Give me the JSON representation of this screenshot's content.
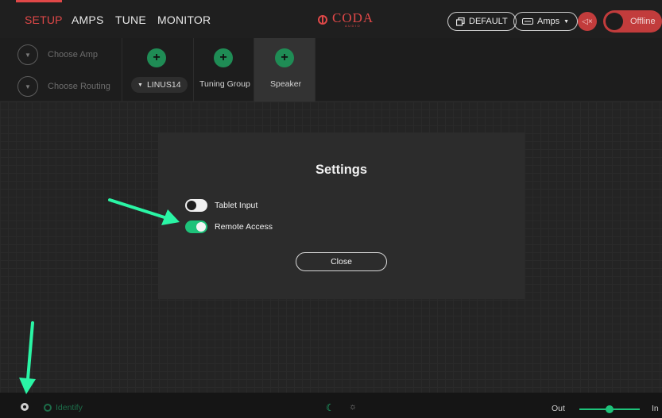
{
  "topbar": {
    "tabs": [
      {
        "label": "SETUP",
        "active": true
      },
      {
        "label": "AMPS",
        "active": false
      },
      {
        "label": "TUNE",
        "active": false
      },
      {
        "label": "MONITOR",
        "active": false
      }
    ],
    "logo": {
      "text": "CODA",
      "sub": "AUDIO"
    },
    "default_label": "DEFAULT",
    "amps_label": "Amps",
    "offline_label": "Offline"
  },
  "subbar": {
    "choose_amp": "Choose Amp",
    "choose_routing": "Choose Routing",
    "groups": [
      {
        "label": "LINUS14",
        "selected": false
      },
      {
        "label": "Tuning Group",
        "selected": false
      },
      {
        "label": "Speaker",
        "selected": true
      }
    ]
  },
  "dialog": {
    "title": "Settings",
    "options": [
      {
        "label": "Tablet Input",
        "enabled": false
      },
      {
        "label": "Remote Access",
        "enabled": true
      }
    ],
    "close_label": "Close"
  },
  "footer": {
    "identify_label": "Identify",
    "slider_out_label": "Out",
    "slider_in_label": "In",
    "slider_value": 0.5
  },
  "colors": {
    "accent_red": "#e04848",
    "accent_green": "#1ec27a",
    "annotation_arrow": "#2af5a5"
  }
}
